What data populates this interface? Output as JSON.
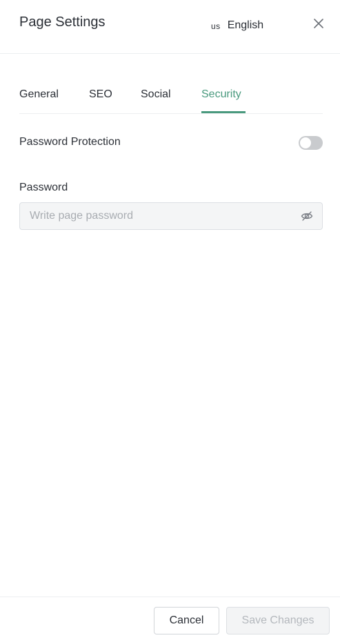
{
  "header": {
    "title": "Page Settings",
    "language_code": "us",
    "language_label": "English"
  },
  "tabs": [
    {
      "label": "General",
      "active": false
    },
    {
      "label": "SEO",
      "active": false
    },
    {
      "label": "Social",
      "active": false
    },
    {
      "label": "Security",
      "active": true
    }
  ],
  "security": {
    "password_protection_label": "Password Protection",
    "password_protection_enabled": false,
    "password_label": "Password",
    "password_value": "",
    "password_placeholder": "Write page password"
  },
  "footer": {
    "cancel_label": "Cancel",
    "save_label": "Save Changes",
    "save_enabled": false
  },
  "icons": {
    "close": "close-icon",
    "password_visibility": "eye-slash-icon"
  },
  "colors": {
    "accent": "#4a9a7e",
    "toggle_off": "#c9cbce",
    "disabled_text": "#b4b8bd"
  }
}
